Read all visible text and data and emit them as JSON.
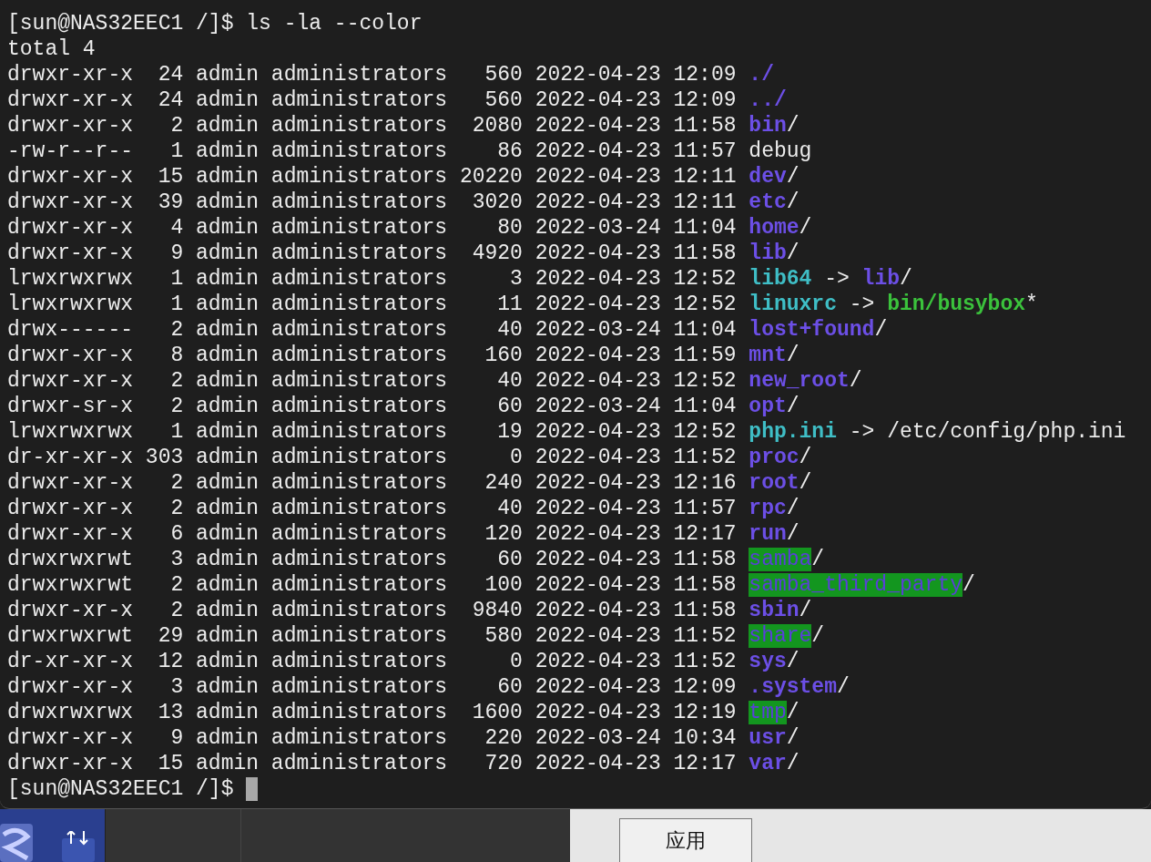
{
  "terminal": {
    "lines": [
      {
        "segments": [
          {
            "text": "[sun@NAS32EEC1 /]$ ls -la --color",
            "kind": "plain"
          }
        ]
      },
      {
        "segments": [
          {
            "text": "total 4",
            "kind": "plain"
          }
        ]
      },
      {
        "segments": [
          {
            "text": "drwxr-xr-x  24 admin administrators   560 2022-04-23 12:09 ",
            "kind": "plain"
          },
          {
            "text": "./",
            "kind": "dir"
          }
        ]
      },
      {
        "segments": [
          {
            "text": "drwxr-xr-x  24 admin administrators   560 2022-04-23 12:09 ",
            "kind": "plain"
          },
          {
            "text": "../",
            "kind": "dir"
          }
        ]
      },
      {
        "segments": [
          {
            "text": "drwxr-xr-x   2 admin administrators  2080 2022-04-23 11:58 ",
            "kind": "plain"
          },
          {
            "text": "bin",
            "kind": "dir"
          },
          {
            "text": "/",
            "kind": "plain"
          }
        ]
      },
      {
        "segments": [
          {
            "text": "-rw-r--r--   1 admin administrators    86 2022-04-23 11:57 debug",
            "kind": "plain"
          }
        ]
      },
      {
        "segments": [
          {
            "text": "drwxr-xr-x  15 admin administrators 20220 2022-04-23 12:11 ",
            "kind": "plain"
          },
          {
            "text": "dev",
            "kind": "dir"
          },
          {
            "text": "/",
            "kind": "plain"
          }
        ]
      },
      {
        "segments": [
          {
            "text": "drwxr-xr-x  39 admin administrators  3020 2022-04-23 12:11 ",
            "kind": "plain"
          },
          {
            "text": "etc",
            "kind": "dir"
          },
          {
            "text": "/",
            "kind": "plain"
          }
        ]
      },
      {
        "segments": [
          {
            "text": "drwxr-xr-x   4 admin administrators    80 2022-03-24 11:04 ",
            "kind": "plain"
          },
          {
            "text": "home",
            "kind": "dir"
          },
          {
            "text": "/",
            "kind": "plain"
          }
        ]
      },
      {
        "segments": [
          {
            "text": "drwxr-xr-x   9 admin administrators  4920 2022-04-23 11:58 ",
            "kind": "plain"
          },
          {
            "text": "lib",
            "kind": "dir"
          },
          {
            "text": "/",
            "kind": "plain"
          }
        ]
      },
      {
        "segments": [
          {
            "text": "lrwxrwxrwx   1 admin administrators     3 2022-04-23 12:52 ",
            "kind": "plain"
          },
          {
            "text": "lib64",
            "kind": "link"
          },
          {
            "text": " -> ",
            "kind": "plain"
          },
          {
            "text": "lib",
            "kind": "dir"
          },
          {
            "text": "/",
            "kind": "plain"
          }
        ]
      },
      {
        "segments": [
          {
            "text": "lrwxrwxrwx   1 admin administrators    11 2022-04-23 12:52 ",
            "kind": "plain"
          },
          {
            "text": "linuxrc",
            "kind": "link"
          },
          {
            "text": " -> ",
            "kind": "plain"
          },
          {
            "text": "bin/busybox",
            "kind": "exec"
          },
          {
            "text": "*",
            "kind": "plain"
          }
        ]
      },
      {
        "segments": [
          {
            "text": "drwx------   2 admin administrators    40 2022-03-24 11:04 ",
            "kind": "plain"
          },
          {
            "text": "lost+found",
            "kind": "dir"
          },
          {
            "text": "/",
            "kind": "plain"
          }
        ]
      },
      {
        "segments": [
          {
            "text": "drwxr-xr-x   8 admin administrators   160 2022-04-23 11:59 ",
            "kind": "plain"
          },
          {
            "text": "mnt",
            "kind": "dir"
          },
          {
            "text": "/",
            "kind": "plain"
          }
        ]
      },
      {
        "segments": [
          {
            "text": "drwxr-xr-x   2 admin administrators    40 2022-04-23 12:52 ",
            "kind": "plain"
          },
          {
            "text": "new_root",
            "kind": "dir"
          },
          {
            "text": "/",
            "kind": "plain"
          }
        ]
      },
      {
        "segments": [
          {
            "text": "drwxr-sr-x   2 admin administrators    60 2022-03-24 11:04 ",
            "kind": "plain"
          },
          {
            "text": "opt",
            "kind": "dir"
          },
          {
            "text": "/",
            "kind": "plain"
          }
        ]
      },
      {
        "segments": [
          {
            "text": "lrwxrwxrwx   1 admin administrators    19 2022-04-23 12:52 ",
            "kind": "plain"
          },
          {
            "text": "php.ini",
            "kind": "link"
          },
          {
            "text": " -> /etc/config/php.ini",
            "kind": "plain"
          }
        ]
      },
      {
        "segments": [
          {
            "text": "dr-xr-xr-x 303 admin administrators     0 2022-04-23 11:52 ",
            "kind": "plain"
          },
          {
            "text": "proc",
            "kind": "dir"
          },
          {
            "text": "/",
            "kind": "plain"
          }
        ]
      },
      {
        "segments": [
          {
            "text": "drwxr-xr-x   2 admin administrators   240 2022-04-23 12:16 ",
            "kind": "plain"
          },
          {
            "text": "root",
            "kind": "dir"
          },
          {
            "text": "/",
            "kind": "plain"
          }
        ]
      },
      {
        "segments": [
          {
            "text": "drwxr-xr-x   2 admin administrators    40 2022-04-23 11:57 ",
            "kind": "plain"
          },
          {
            "text": "rpc",
            "kind": "dir"
          },
          {
            "text": "/",
            "kind": "plain"
          }
        ]
      },
      {
        "segments": [
          {
            "text": "drwxr-xr-x   6 admin administrators   120 2022-04-23 12:17 ",
            "kind": "plain"
          },
          {
            "text": "run",
            "kind": "dir"
          },
          {
            "text": "/",
            "kind": "plain"
          }
        ]
      },
      {
        "segments": [
          {
            "text": "drwxrwxrwt   3 admin administrators    60 2022-04-23 11:58 ",
            "kind": "plain"
          },
          {
            "text": "samba",
            "kind": "sticky"
          },
          {
            "text": "/",
            "kind": "plain"
          }
        ]
      },
      {
        "segments": [
          {
            "text": "drwxrwxrwt   2 admin administrators   100 2022-04-23 11:58 ",
            "kind": "plain"
          },
          {
            "text": "samba_third_party",
            "kind": "sticky"
          },
          {
            "text": "/",
            "kind": "plain"
          }
        ]
      },
      {
        "segments": [
          {
            "text": "drwxr-xr-x   2 admin administrators  9840 2022-04-23 11:58 ",
            "kind": "plain"
          },
          {
            "text": "sbin",
            "kind": "dir"
          },
          {
            "text": "/",
            "kind": "plain"
          }
        ]
      },
      {
        "segments": [
          {
            "text": "drwxrwxrwt  29 admin administrators   580 2022-04-23 11:52 ",
            "kind": "plain"
          },
          {
            "text": "share",
            "kind": "sticky"
          },
          {
            "text": "/",
            "kind": "plain"
          }
        ]
      },
      {
        "segments": [
          {
            "text": "dr-xr-xr-x  12 admin administrators     0 2022-04-23 11:52 ",
            "kind": "plain"
          },
          {
            "text": "sys",
            "kind": "dir"
          },
          {
            "text": "/",
            "kind": "plain"
          }
        ]
      },
      {
        "segments": [
          {
            "text": "drwxr-xr-x   3 admin administrators    60 2022-04-23 12:09 ",
            "kind": "plain"
          },
          {
            "text": ".system",
            "kind": "dir"
          },
          {
            "text": "/",
            "kind": "plain"
          }
        ]
      },
      {
        "segments": [
          {
            "text": "drwxrwxrwx  13 admin administrators  1600 2022-04-23 12:19 ",
            "kind": "plain"
          },
          {
            "text": "tmp",
            "kind": "sticky"
          },
          {
            "text": "/",
            "kind": "plain"
          }
        ]
      },
      {
        "segments": [
          {
            "text": "drwxr-xr-x   9 admin administrators   220 2022-03-24 10:34 ",
            "kind": "plain"
          },
          {
            "text": "usr",
            "kind": "dir"
          },
          {
            "text": "/",
            "kind": "plain"
          }
        ]
      },
      {
        "segments": [
          {
            "text": "drwxr-xr-x  15 admin administrators   720 2022-04-23 12:17 ",
            "kind": "plain"
          },
          {
            "text": "var",
            "kind": "dir"
          },
          {
            "text": "/",
            "kind": "plain"
          }
        ]
      },
      {
        "segments": [
          {
            "text": "[sun@NAS32EEC1 /]$ ",
            "kind": "plain"
          }
        ],
        "cursor": true
      }
    ]
  },
  "desktop": {
    "apply_button": "应用"
  }
}
